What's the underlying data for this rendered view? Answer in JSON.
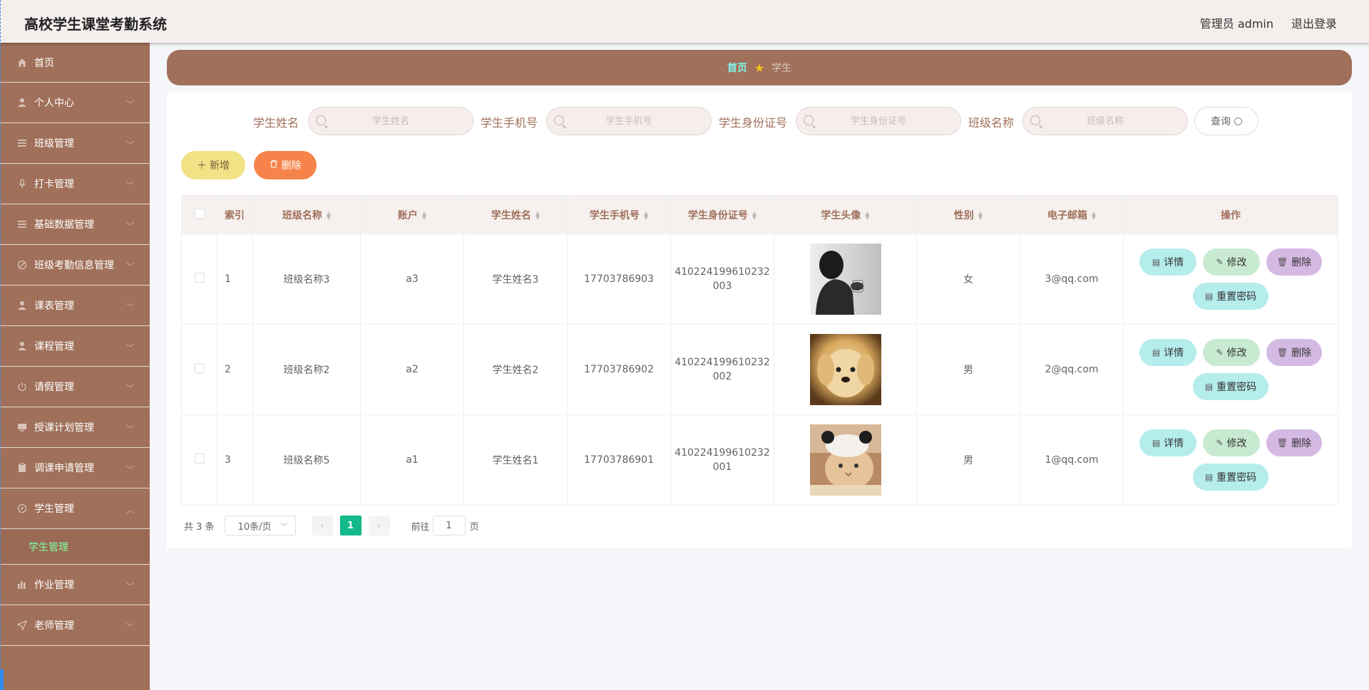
{
  "header": {
    "title": "高校学生课堂考勤系统",
    "admin_label": "管理员 admin",
    "logout_label": "退出登录"
  },
  "sidebar": {
    "items": [
      {
        "label": "首页",
        "icon": "home-icon"
      },
      {
        "label": "个人中心",
        "icon": "user-icon"
      },
      {
        "label": "班级管理",
        "icon": "list-icon"
      },
      {
        "label": "打卡管理",
        "icon": "microphone-icon"
      },
      {
        "label": "基础数据管理",
        "icon": "list-icon"
      },
      {
        "label": "班级考勤信息管理",
        "icon": "reading-icon"
      },
      {
        "label": "课表管理",
        "icon": "user-icon"
      },
      {
        "label": "课程管理",
        "icon": "user-icon"
      },
      {
        "label": "请假管理",
        "icon": "power-icon"
      },
      {
        "label": "授课计划管理",
        "icon": "monitor-icon"
      },
      {
        "label": "调课申请管理",
        "icon": "clipboard-icon"
      },
      {
        "label": "学生管理",
        "icon": "compass-icon"
      }
    ],
    "submenu_active": "学生管理",
    "items_after": [
      {
        "label": "作业管理",
        "icon": "chart-icon"
      },
      {
        "label": "老师管理",
        "icon": "send-icon"
      }
    ]
  },
  "breadcrumb": {
    "home": "首页",
    "current": "学生"
  },
  "search": {
    "fields": [
      {
        "label": "学生姓名",
        "placeholder": "学生姓名"
      },
      {
        "label": "学生手机号",
        "placeholder": "学生手机号"
      },
      {
        "label": "学生身份证号",
        "placeholder": "学生身份证号"
      },
      {
        "label": "班级名称",
        "placeholder": "班级名称"
      }
    ],
    "query_label": "查询"
  },
  "actions": {
    "add_label": "新增",
    "delete_label": "删除"
  },
  "table": {
    "columns": [
      "索引",
      "班级名称",
      "账户",
      "学生姓名",
      "学生手机号",
      "学生身份证号",
      "学生头像",
      "性别",
      "电子邮箱",
      "操作"
    ],
    "rows": [
      {
        "index": "1",
        "class": "班级名称3",
        "account": "a3",
        "name": "学生姓名3",
        "phone": "17703786903",
        "id_line1": "410224199610232",
        "id_line2": "003",
        "avatar": "photo-man-portrait",
        "gender": "女",
        "email": "3@qq.com"
      },
      {
        "index": "2",
        "class": "班级名称2",
        "account": "a2",
        "name": "学生姓名2",
        "phone": "17703786902",
        "id_line1": "410224199610232",
        "id_line2": "002",
        "avatar": "photo-puppy",
        "gender": "男",
        "email": "2@qq.com"
      },
      {
        "index": "3",
        "class": "班级名称5",
        "account": "a1",
        "name": "学生姓名1",
        "phone": "17703786901",
        "id_line1": "410224199610232",
        "id_line2": "001",
        "avatar": "photo-kitten",
        "gender": "男",
        "email": "1@qq.com"
      }
    ],
    "op_labels": {
      "detail": "详情",
      "edit": "修改",
      "delete": "删除",
      "reset": "重置密码"
    }
  },
  "pagination": {
    "total": "共 3 条",
    "page_size": "10条/页",
    "current_page": "1",
    "goto_label": "前往",
    "goto_value": "1",
    "page_suffix": "页"
  },
  "colors": {
    "sidebar": "#a0705a",
    "accent_green": "#12b98a",
    "add_button": "#f1e285",
    "delete_button": "#f6844a"
  }
}
